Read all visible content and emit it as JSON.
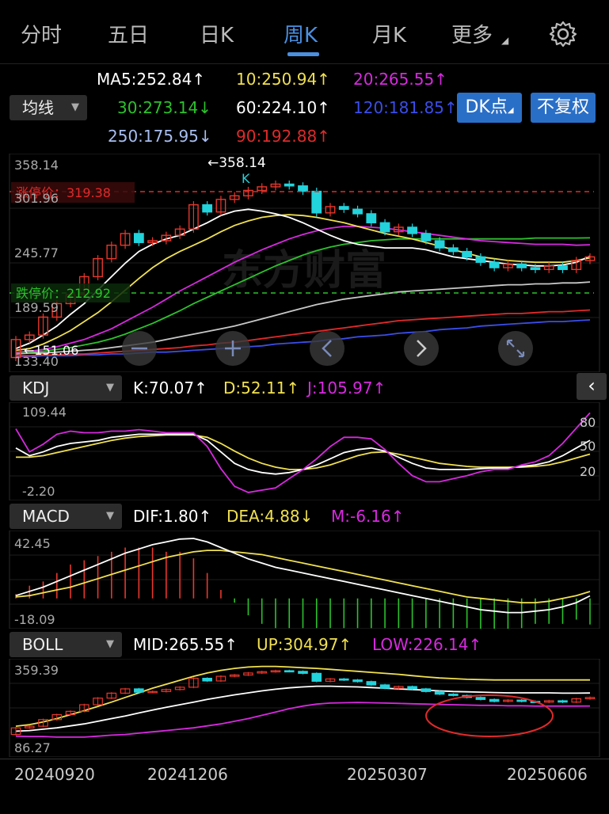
{
  "tabs": [
    {
      "label": "分时",
      "active": false
    },
    {
      "label": "五日",
      "active": false
    },
    {
      "label": "日K",
      "active": false
    },
    {
      "label": "周K",
      "active": true
    },
    {
      "label": "月K",
      "active": false
    },
    {
      "label": "更多",
      "active": false
    }
  ],
  "ma": {
    "ma5": "MA5:252.84",
    "ma10": "10:250.94",
    "ma20": "20:265.55",
    "ma30": "30:273.14",
    "ma60": "60:224.10",
    "ma120": "120:181.85",
    "ma250": "250:175.95",
    "ma90": "90:192.88",
    "arrow_up": "↑",
    "arrow_down": "↓"
  },
  "controls": {
    "indicator_select": "均线",
    "dk_button": "DK点",
    "fq_button": "不复权"
  },
  "main_chart": {
    "y_top": "358.14",
    "y_301": "301.96",
    "y_245": "245.77",
    "y_189": "189.59",
    "y_bottom": "133.40",
    "high_marker": "←358.14",
    "low_marker": "←151.06",
    "k_marker": "K",
    "limit_up": "涨停价：319.38",
    "limit_down": "跌停价：212.92",
    "watermark": "东方财富"
  },
  "kdj": {
    "select": "KDJ",
    "k": "K:70.07",
    "d": "D:52.11",
    "j": "J:105.97",
    "y_top": "109.44",
    "y_bottom": "-2.20",
    "lvl80": "80",
    "lvl50": "50",
    "lvl20": "20"
  },
  "macd": {
    "select": "MACD",
    "dif": "DIF:1.80",
    "dea": "DEA:4.88",
    "m": "M:-6.16",
    "y_top": "42.45",
    "y_bottom": "-18.09"
  },
  "boll": {
    "select": "BOLL",
    "mid": "MID:265.55",
    "up": "UP:304.97",
    "low": "LOW:226.14",
    "y_top": "359.39",
    "y_bottom": "86.27"
  },
  "dates": [
    "20240920",
    "20241206",
    "20250307",
    "20250606"
  ],
  "colors": {
    "up": "#e8372c",
    "down": "#22d3dc",
    "white": "#ffffff",
    "yellow": "#f0e050",
    "magenta": "#d829e0",
    "green": "#2cc22c",
    "blue": "#3b4ee8",
    "gray": "#c8c8c8",
    "red": "#e02a2a",
    "accent": "#4a8fe0"
  },
  "chart_data": {
    "type": "line",
    "title": "",
    "period": "weekly",
    "candles_approx": [
      {
        "o": 140,
        "c": 160
      },
      {
        "o": 160,
        "c": 165
      },
      {
        "o": 165,
        "c": 185
      },
      {
        "o": 185,
        "c": 200
      },
      {
        "o": 200,
        "c": 210
      },
      {
        "o": 210,
        "c": 230
      },
      {
        "o": 230,
        "c": 250
      },
      {
        "o": 250,
        "c": 265
      },
      {
        "o": 265,
        "c": 278
      },
      {
        "o": 278,
        "c": 268
      },
      {
        "o": 268,
        "c": 270
      },
      {
        "o": 270,
        "c": 276
      },
      {
        "o": 276,
        "c": 283
      },
      {
        "o": 283,
        "c": 310
      },
      {
        "o": 310,
        "c": 302
      },
      {
        "o": 302,
        "c": 316
      },
      {
        "o": 316,
        "c": 320
      },
      {
        "o": 320,
        "c": 326
      },
      {
        "o": 326,
        "c": 330
      },
      {
        "o": 330,
        "c": 333
      },
      {
        "o": 333,
        "c": 331
      },
      {
        "o": 331,
        "c": 325
      },
      {
        "o": 325,
        "c": 301
      },
      {
        "o": 301,
        "c": 308
      },
      {
        "o": 308,
        "c": 305
      },
      {
        "o": 305,
        "c": 300
      },
      {
        "o": 300,
        "c": 290
      },
      {
        "o": 290,
        "c": 280
      },
      {
        "o": 280,
        "c": 285
      },
      {
        "o": 285,
        "c": 278
      },
      {
        "o": 278,
        "c": 270
      },
      {
        "o": 270,
        "c": 262
      },
      {
        "o": 262,
        "c": 258
      },
      {
        "o": 258,
        "c": 252
      },
      {
        "o": 252,
        "c": 246
      },
      {
        "o": 246,
        "c": 240
      },
      {
        "o": 240,
        "c": 244
      },
      {
        "o": 244,
        "c": 240
      },
      {
        "o": 240,
        "c": 238
      },
      {
        "o": 238,
        "c": 242
      },
      {
        "o": 242,
        "c": 238
      },
      {
        "o": 238,
        "c": 248
      },
      {
        "o": 248,
        "c": 252
      }
    ],
    "ma_lines": {
      "ma5": [
        150,
        156,
        165,
        175,
        188,
        200,
        215,
        230,
        245,
        258,
        266,
        272,
        276,
        283,
        290,
        298,
        303,
        305,
        303,
        300,
        296,
        290,
        283,
        276,
        270,
        266,
        264,
        262,
        262,
        262,
        260,
        256,
        252,
        250,
        248,
        246,
        244,
        243,
        242,
        242,
        243,
        246,
        252.84
      ],
      "ma10": [
        148,
        150,
        155,
        162,
        170,
        180,
        190,
        202,
        215,
        228,
        240,
        250,
        258,
        265,
        272,
        280,
        287,
        292,
        296,
        298,
        299,
        298,
        296,
        293,
        290,
        286,
        282,
        278,
        275,
        272,
        268,
        264,
        260,
        256,
        252,
        250,
        248,
        247,
        246,
        246,
        246,
        248,
        250.94
      ],
      "ma20": [
        146,
        147,
        149,
        152,
        156,
        160,
        166,
        172,
        180,
        188,
        196,
        205,
        214,
        222,
        230,
        238,
        246,
        253,
        260,
        266,
        272,
        277,
        281,
        284,
        286,
        286,
        285,
        284,
        282,
        280,
        278,
        276,
        274,
        272,
        270,
        269,
        268,
        267,
        266,
        266,
        266,
        265,
        265.55
      ],
      "ma30": [
        145,
        146,
        147,
        149,
        151,
        154,
        157,
        161,
        166,
        172,
        178,
        185,
        192,
        200,
        207,
        214,
        221,
        228,
        235,
        242,
        248,
        254,
        259,
        263,
        266,
        268,
        270,
        271,
        272,
        272,
        272,
        272,
        272,
        272,
        272,
        272,
        272,
        272,
        273,
        273,
        273,
        273,
        273.14
      ],
      "ma60": [
        144,
        145,
        145,
        146,
        147,
        148,
        149,
        151,
        153,
        155,
        157,
        160,
        163,
        166,
        169,
        172,
        175,
        179,
        183,
        187,
        191,
        195,
        199,
        202,
        205,
        207,
        209,
        211,
        213,
        214,
        215,
        216,
        217,
        218,
        219,
        220,
        221,
        221,
        222,
        222,
        223,
        223,
        224.1
      ],
      "ma90": [
        142,
        142,
        143,
        143,
        144,
        144,
        145,
        146,
        147,
        148,
        149,
        150,
        151,
        153,
        154,
        156,
        157,
        159,
        161,
        163,
        165,
        167,
        169,
        171,
        173,
        175,
        177,
        179,
        181,
        182,
        183,
        184,
        185,
        186,
        187,
        188,
        189,
        189,
        190,
        191,
        191,
        192,
        192.88
      ],
      "ma120": [
        141,
        141,
        142,
        142,
        142,
        143,
        143,
        144,
        144,
        145,
        146,
        146,
        147,
        148,
        149,
        150,
        151,
        152,
        153,
        155,
        156,
        157,
        158,
        160,
        161,
        163,
        164,
        165,
        167,
        168,
        169,
        171,
        172,
        173,
        175,
        176,
        177,
        178,
        179,
        180,
        180,
        181,
        181.85
      ],
      "ma250": [
        175.95
      ]
    },
    "y_range": [
      133.4,
      358.14
    ],
    "kdj": {
      "K": [
        60,
        50,
        55,
        62,
        66,
        68,
        70,
        74,
        76,
        78,
        78,
        78,
        78,
        78,
        70,
        55,
        40,
        32,
        28,
        26,
        28,
        32,
        38,
        46,
        54,
        58,
        60,
        56,
        48,
        40,
        34,
        32,
        32,
        32,
        33,
        34,
        34,
        36,
        38,
        42,
        50,
        60,
        70.07
      ],
      "D": [
        48,
        48,
        50,
        54,
        58,
        62,
        66,
        70,
        73,
        75,
        76,
        77,
        77,
        77,
        74,
        66,
        56,
        47,
        40,
        35,
        32,
        32,
        34,
        38,
        44,
        50,
        54,
        55,
        52,
        48,
        44,
        40,
        38,
        36,
        35,
        35,
        35,
        35,
        36,
        38,
        42,
        47,
        52.11
      ],
      "J": [
        85,
        55,
        65,
        78,
        82,
        80,
        80,
        82,
        82,
        84,
        82,
        80,
        80,
        80,
        62,
        33,
        10,
        2,
        5,
        8,
        20,
        32,
        46,
        62,
        74,
        74,
        72,
        58,
        40,
        24,
        16,
        16,
        20,
        24,
        29,
        32,
        32,
        38,
        42,
        50,
        66,
        86,
        105.97
      ],
      "y_range": [
        -2.2,
        109.44
      ]
    },
    "macd": {
      "DIF": [
        2,
        5,
        8,
        12,
        16,
        20,
        24,
        28,
        32,
        35,
        38,
        40,
        42,
        42.45,
        40,
        36,
        32,
        28,
        25,
        22,
        20,
        18,
        16,
        14,
        12,
        10,
        8,
        6,
        4,
        2,
        0,
        -2,
        -4,
        -6,
        -8,
        -9,
        -10,
        -10,
        -9,
        -8,
        -6,
        -3,
        1.8
      ],
      "DEA": [
        1,
        2,
        4,
        6,
        8,
        11,
        14,
        17,
        20,
        23,
        26,
        29,
        31,
        33,
        34,
        34,
        33,
        32,
        31,
        29,
        27,
        25,
        23,
        21,
        19,
        17,
        15,
        13,
        11,
        9,
        7,
        5,
        3,
        1,
        0,
        -1,
        -2,
        -3,
        -3,
        -2,
        0,
        2,
        4.88
      ],
      "M": [
        1,
        3,
        4,
        6,
        8,
        9,
        10,
        11,
        12,
        12,
        12,
        11,
        11,
        9.45,
        6,
        2,
        -1,
        -4,
        -6,
        -7,
        -7,
        -7,
        -7,
        -7,
        -7,
        -7,
        -7,
        -7,
        -7,
        -7,
        -7,
        -7,
        -7,
        -7,
        -8,
        -8,
        -8,
        -7,
        -6,
        -6,
        -6,
        -5,
        -6.16
      ],
      "y_range": [
        -18.09,
        42.45
      ]
    },
    "boll": {
      "MID": [
        150,
        152,
        156,
        160,
        166,
        172,
        180,
        188,
        196,
        205,
        214,
        222,
        230,
        238,
        246,
        253,
        260,
        266,
        272,
        277,
        281,
        284,
        286,
        286,
        285,
        284,
        282,
        280,
        278,
        276,
        274,
        272,
        270,
        269,
        268,
        267,
        266,
        266,
        266,
        266,
        265,
        265,
        265.55
      ],
      "UP": [
        165,
        170,
        178,
        188,
        200,
        212,
        225,
        238,
        252,
        266,
        280,
        292,
        304,
        316,
        326,
        334,
        340,
        344,
        346,
        346,
        344,
        342,
        340,
        337,
        334,
        331,
        328,
        325,
        322,
        318,
        314,
        311,
        309,
        307,
        306,
        305,
        305,
        305,
        305,
        305,
        305,
        305,
        304.97
      ],
      "LOW": [
        135,
        134,
        134,
        132,
        132,
        132,
        135,
        138,
        140,
        144,
        148,
        152,
        156,
        160,
        166,
        172,
        180,
        188,
        198,
        208,
        218,
        226,
        232,
        235,
        236,
        237,
        236,
        235,
        234,
        233,
        232,
        231,
        230,
        229,
        228,
        228,
        227,
        227,
        226,
        226,
        226,
        226,
        226.14
      ],
      "y_range": [
        86.27,
        359.39
      ]
    },
    "x_labels": [
      "20240920",
      "20241206",
      "20250307",
      "20250606"
    ]
  }
}
